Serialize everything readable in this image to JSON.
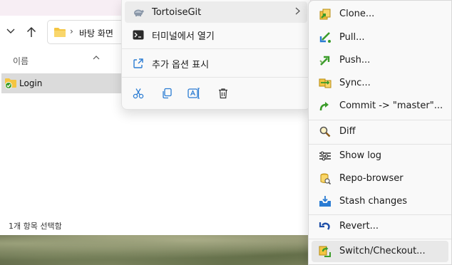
{
  "explorer": {
    "address_path": "바탕 화면",
    "column_header_name": "이름",
    "folder_name": "Login",
    "status_text": "1개 항목 선택함"
  },
  "context_menu": {
    "items": [
      {
        "label": "TortoiseGit",
        "icon": "tortoise-icon",
        "has_submenu": true
      },
      {
        "label": "터미널에서 열기",
        "icon": "terminal-icon"
      },
      {
        "label": "추가 옵션 표시",
        "icon": "more-options-icon"
      }
    ],
    "actions": [
      {
        "icon": "cut-icon"
      },
      {
        "icon": "copy-icon"
      },
      {
        "icon": "rename-icon"
      },
      {
        "icon": "delete-icon"
      }
    ]
  },
  "submenu": {
    "items": [
      {
        "label": "Clone...",
        "icon": "clone-icon"
      },
      {
        "label": "Pull...",
        "icon": "pull-icon"
      },
      {
        "label": "Push...",
        "icon": "push-icon"
      },
      {
        "label": "Sync...",
        "icon": "sync-icon"
      },
      {
        "label": "Commit -> \"master\"...",
        "icon": "commit-icon"
      },
      {
        "label": "Diff",
        "icon": "diff-icon"
      },
      {
        "label": "Show log",
        "icon": "log-icon"
      },
      {
        "label": "Repo-browser",
        "icon": "repo-browser-icon"
      },
      {
        "label": "Stash changes",
        "icon": "stash-icon"
      },
      {
        "label": "Revert...",
        "icon": "revert-icon"
      },
      {
        "label": "Switch/Checkout...",
        "icon": "switch-checkout-icon"
      }
    ]
  },
  "colors": {
    "accent_blue": "#2b7cd3",
    "git_green": "#3b9c2a",
    "folder_yellow": "#f4c542"
  }
}
